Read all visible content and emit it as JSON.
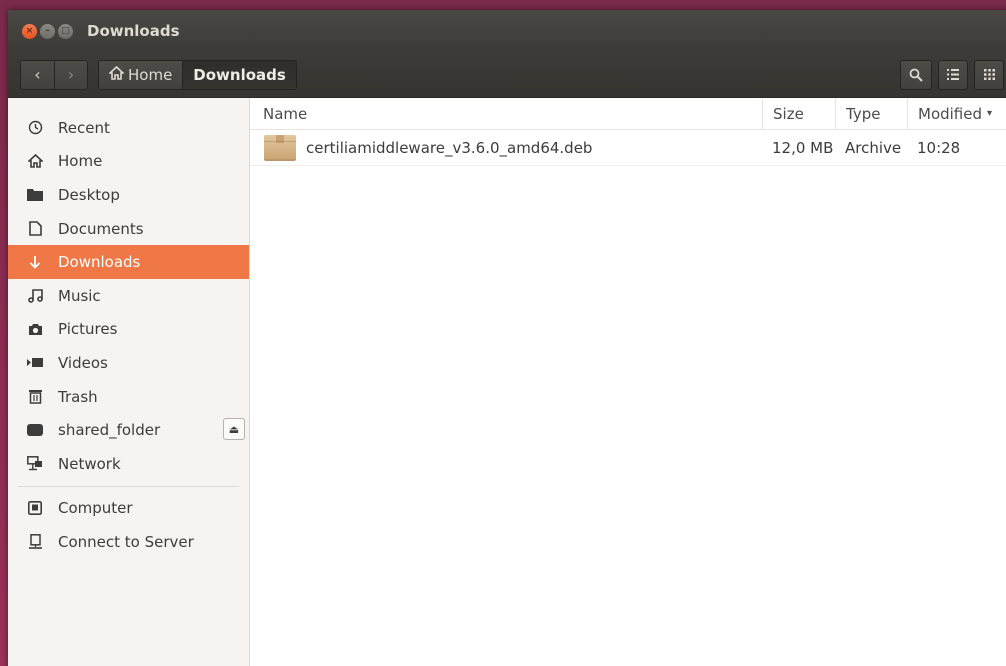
{
  "window": {
    "title": "Downloads",
    "buttons": {
      "close": "×",
      "minimize": "–",
      "maximize": "□"
    }
  },
  "toolbar": {
    "back_glyph": "‹",
    "forward_glyph": "›",
    "path": [
      {
        "label": "Home",
        "icon": "home-icon"
      },
      {
        "label": "Downloads"
      }
    ],
    "search_icon": "search-icon",
    "list_view_icon": "list-view-icon",
    "grid_view_icon": "grid-view-icon"
  },
  "sidebar": {
    "items": [
      {
        "label": "Recent",
        "icon": "clock-icon"
      },
      {
        "label": "Home",
        "icon": "home-icon"
      },
      {
        "label": "Desktop",
        "icon": "folder-icon"
      },
      {
        "label": "Documents",
        "icon": "document-icon"
      },
      {
        "label": "Downloads",
        "icon": "download-icon",
        "active": true
      },
      {
        "label": "Music",
        "icon": "music-icon"
      },
      {
        "label": "Pictures",
        "icon": "camera-icon"
      },
      {
        "label": "Videos",
        "icon": "video-icon"
      },
      {
        "label": "Trash",
        "icon": "trash-icon"
      },
      {
        "label": "shared_folder",
        "icon": "drive-icon",
        "eject": true
      },
      {
        "label": "Network",
        "icon": "network-icon"
      }
    ],
    "devices": [
      {
        "label": "Computer",
        "icon": "computer-icon"
      },
      {
        "label": "Connect to Server",
        "icon": "server-icon"
      }
    ],
    "eject_glyph": "⏏"
  },
  "file_list": {
    "columns": {
      "name": "Name",
      "size": "Size",
      "type": "Type",
      "modified": "Modified",
      "sort_glyph": "▾"
    },
    "rows": [
      {
        "name": "certiliamiddleware_v3.6.0_amd64.deb",
        "size": "12,0 MB",
        "type": "Archive",
        "modified": "10:28",
        "icon": "package-icon"
      }
    ]
  },
  "colors": {
    "accent": "#f07746",
    "titlebar": "#3c3b37",
    "desktop": "#8a2c52"
  }
}
